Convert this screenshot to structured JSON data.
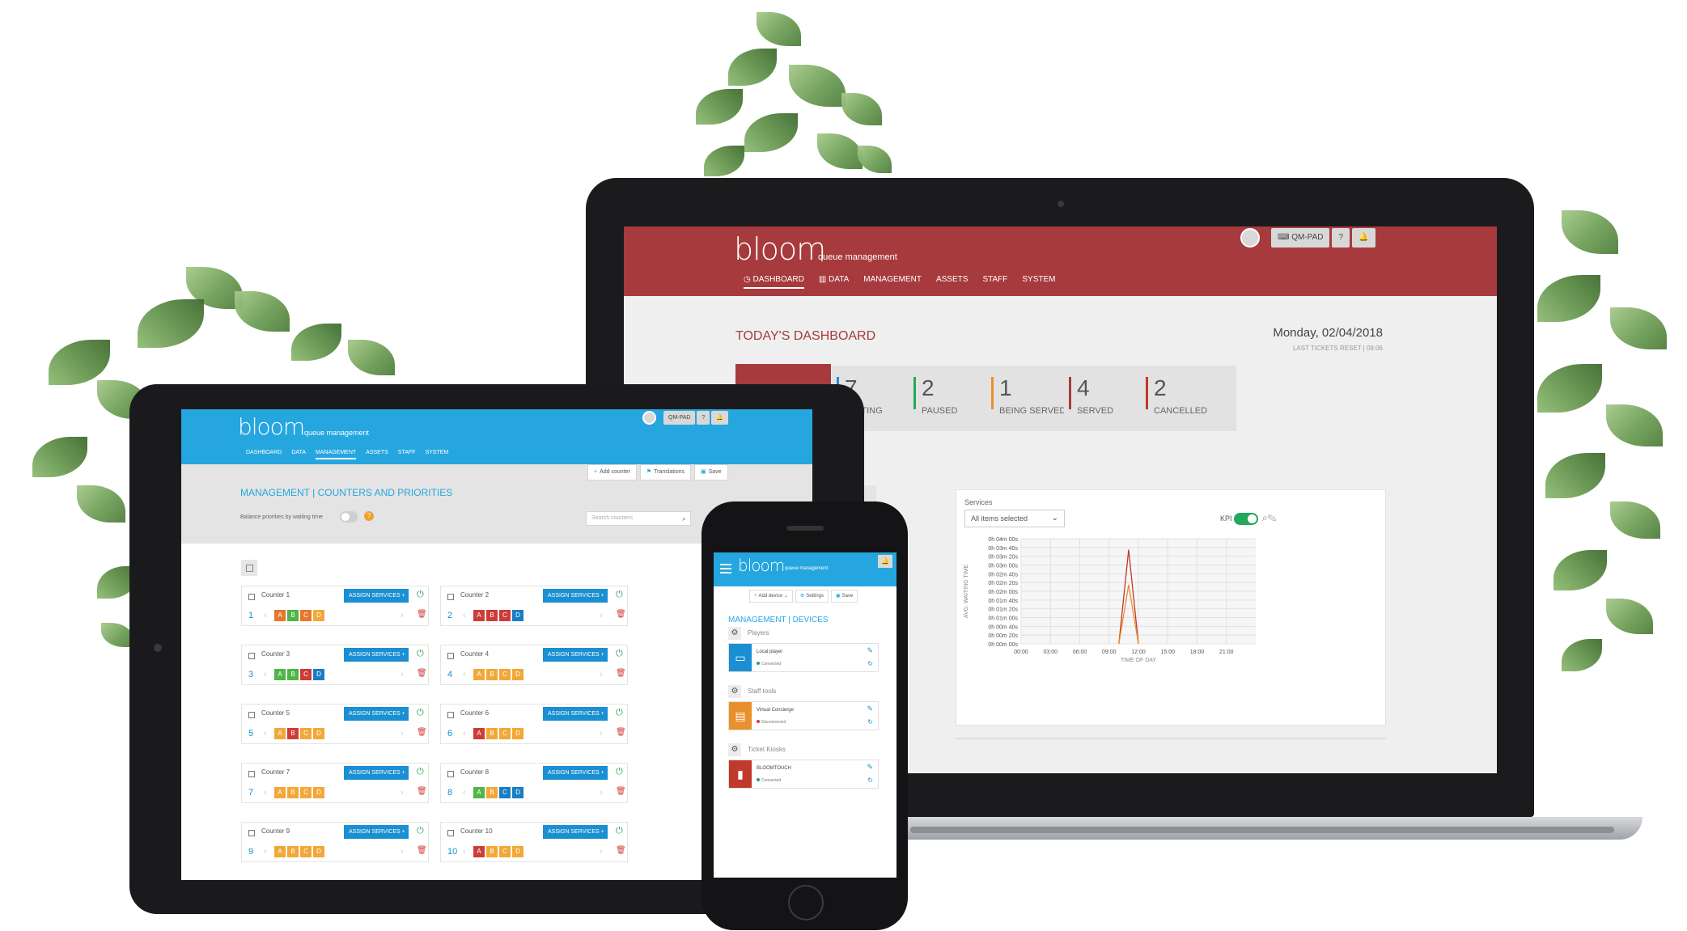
{
  "colors": {
    "laptop_header": "#a63a3d",
    "tablet_header": "#25a6df",
    "accent_blue": "#1a8fd2",
    "chip_a": "#e8762d",
    "chip_b": "#4fb548",
    "chip_red": "#cc3d38",
    "chip_blue": "#1a7ec4",
    "chip_amber": "#f2a838"
  },
  "laptop": {
    "brand": "bloom",
    "brand_sub": "queue management",
    "account": "QM-PAD",
    "help": "?",
    "bell_icon": "bell-icon",
    "nav": [
      "DASHBOARD",
      "DATA",
      "MANAGEMENT",
      "ASSETS",
      "STAFF",
      "SYSTEM"
    ],
    "title": "TODAY'S DASHBOARD",
    "date": "Monday, 02/04/2018",
    "last_reset": "LAST TICKETS RESET | 09:06",
    "stats": [
      {
        "value": "7",
        "label": "WAITING",
        "color": "#1a8fd2"
      },
      {
        "value": "2",
        "label": "PAUSED",
        "color": "#23a85b"
      },
      {
        "value": "1",
        "label": "BEING SERVED",
        "color": "#e8902d"
      },
      {
        "value": "4",
        "label": "SERVED",
        "color": "#a63a3d"
      },
      {
        "value": "2",
        "label": "CANCELLED",
        "color": "#c0392b"
      }
    ],
    "chart_card": {
      "label": "Services",
      "select": "All items selected",
      "kpi": "KPI",
      "kpi_on": true
    }
  },
  "chart_data": {
    "type": "line",
    "ylabel": "AVG. WAITING TIME",
    "xlabel": "TIME OF DAY",
    "x_ticks": [
      "00:00",
      "03:00",
      "06:00",
      "09:00",
      "12:00",
      "15:00",
      "18:00",
      "21:00"
    ],
    "y_ticks": [
      "0h 04m 00s",
      "0h 03m 40s",
      "0h 03m 20s",
      "0h 03m 00s",
      "0h 02m 40s",
      "0h 02m 20s",
      "0h 02m 00s",
      "0h 01m 40s",
      "0h 01m 20s",
      "0h 01m 00s",
      "0h 00m 40s",
      "0h 00m 20s",
      "0h 00m 00s"
    ],
    "ylim_seconds": [
      0,
      240
    ],
    "grid": true,
    "series": [
      {
        "color": "#c0392b",
        "points": [
          {
            "x": "10:00",
            "y": 0
          },
          {
            "x": "11:00",
            "y": 215
          },
          {
            "x": "12:00",
            "y": 0
          }
        ]
      },
      {
        "color": "#e8902d",
        "points": [
          {
            "x": "10:00",
            "y": 0
          },
          {
            "x": "11:00",
            "y": 135
          },
          {
            "x": "12:00",
            "y": 0
          }
        ]
      }
    ]
  },
  "tablet": {
    "brand": "bloom",
    "brand_sub": "queue management",
    "account": "QM-PAD",
    "help": "?",
    "nav": [
      "DASHBOARD",
      "DATA",
      "MANAGEMENT",
      "ASSETS",
      "STAFF",
      "SYSTEM"
    ],
    "actions": [
      "Add counter",
      "Translations",
      "Save"
    ],
    "title": "MANAGEMENT | COUNTERS AND PRIORITIES",
    "balance_label": "Balance priorities by waiting time",
    "search_placeholder": "Search counters",
    "assign_label": "ASSIGN SERVICES +",
    "counters": [
      {
        "name": "Counter 1",
        "number": "1",
        "chips": [
          {
            "t": "A",
            "c": "#e8762d"
          },
          {
            "t": "B",
            "c": "#4fb548"
          },
          {
            "t": "C",
            "c": "#e8762d"
          },
          {
            "t": "D",
            "c": "#f2a838"
          }
        ]
      },
      {
        "name": "Counter 2",
        "number": "2",
        "chips": [
          {
            "t": "A",
            "c": "#cc3d38"
          },
          {
            "t": "B",
            "c": "#cc3d38"
          },
          {
            "t": "C",
            "c": "#cc3d38"
          },
          {
            "t": "D",
            "c": "#1a7ec4"
          }
        ]
      },
      {
        "name": "Counter 3",
        "number": "3",
        "chips": [
          {
            "t": "A",
            "c": "#4fb548"
          },
          {
            "t": "B",
            "c": "#4fb548"
          },
          {
            "t": "C",
            "c": "#cc3d38"
          },
          {
            "t": "D",
            "c": "#1a7ec4"
          }
        ]
      },
      {
        "name": "Counter 4",
        "number": "4",
        "chips": [
          {
            "t": "A",
            "c": "#f2a838"
          },
          {
            "t": "B",
            "c": "#f2a838"
          },
          {
            "t": "C",
            "c": "#f2a838"
          },
          {
            "t": "D",
            "c": "#f2a838"
          }
        ]
      },
      {
        "name": "Counter 5",
        "number": "5",
        "chips": [
          {
            "t": "A",
            "c": "#f2a838"
          },
          {
            "t": "B",
            "c": "#cc3d38"
          },
          {
            "t": "C",
            "c": "#f2a838"
          },
          {
            "t": "D",
            "c": "#f2a838"
          }
        ]
      },
      {
        "name": "Counter 6",
        "number": "6",
        "chips": [
          {
            "t": "A",
            "c": "#cc3d38"
          },
          {
            "t": "B",
            "c": "#f2a838"
          },
          {
            "t": "C",
            "c": "#f2a838"
          },
          {
            "t": "D",
            "c": "#f2a838"
          }
        ]
      },
      {
        "name": "Counter 7",
        "number": "7",
        "chips": [
          {
            "t": "A",
            "c": "#f2a838"
          },
          {
            "t": "B",
            "c": "#f2a838"
          },
          {
            "t": "C",
            "c": "#f2a838"
          },
          {
            "t": "D",
            "c": "#f2a838"
          }
        ]
      },
      {
        "name": "Counter 8",
        "number": "8",
        "chips": [
          {
            "t": "A",
            "c": "#4fb548"
          },
          {
            "t": "B",
            "c": "#f2a838"
          },
          {
            "t": "C",
            "c": "#1a7ec4"
          },
          {
            "t": "D",
            "c": "#1a7ec4"
          }
        ]
      },
      {
        "name": "Counter 9",
        "number": "9",
        "chips": [
          {
            "t": "A",
            "c": "#f2a838"
          },
          {
            "t": "B",
            "c": "#f2a838"
          },
          {
            "t": "C",
            "c": "#f2a838"
          },
          {
            "t": "D",
            "c": "#f2a838"
          }
        ]
      },
      {
        "name": "Counter 10",
        "number": "10",
        "chips": [
          {
            "t": "A",
            "c": "#cc3d38"
          },
          {
            "t": "B",
            "c": "#f2a838"
          },
          {
            "t": "C",
            "c": "#f2a838"
          },
          {
            "t": "D",
            "c": "#f2a838"
          }
        ]
      }
    ]
  },
  "phone": {
    "brand": "bloom",
    "brand_sub": "queue management",
    "actions": [
      "Add device",
      "Settings",
      "Save"
    ],
    "title": "MANAGEMENT | DEVICES",
    "sections": [
      {
        "label": "Players",
        "device": {
          "name": "Local player",
          "status": "Connected",
          "status_color": "#23a85b",
          "icon_bg": "#1a8fd2",
          "icon": "monitor-icon"
        }
      },
      {
        "label": "Staff tools",
        "device": {
          "name": "Virtual Concierge",
          "status": "Disconnected",
          "status_color": "#cc3d38",
          "icon_bg": "#e8902d",
          "icon": "concierge-icon"
        }
      },
      {
        "label": "Ticket Kiosks",
        "device": {
          "name": "BLOOMTOUCH",
          "status": "Connected",
          "status_color": "#23a85b",
          "icon_bg": "#c0392b",
          "icon": "kiosk-icon"
        }
      }
    ]
  }
}
